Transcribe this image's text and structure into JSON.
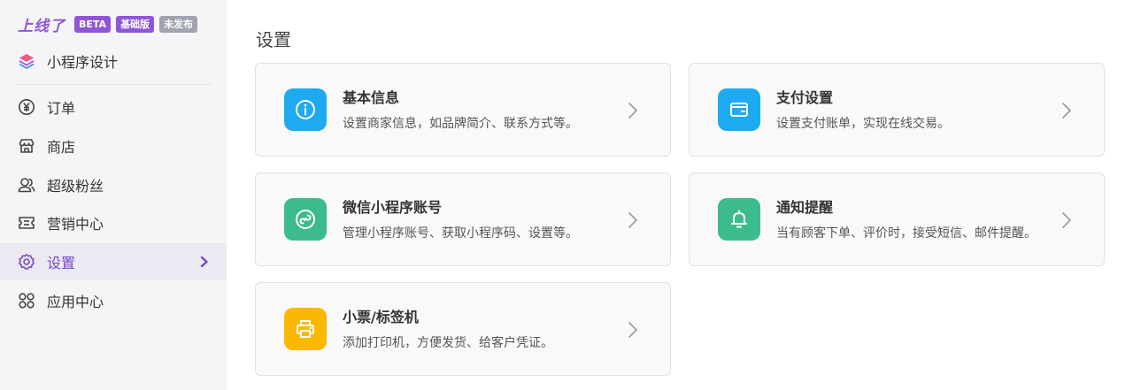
{
  "brand": {
    "logo": "上线了",
    "badges": [
      "BETA",
      "基础版",
      "未发布"
    ]
  },
  "sidebar": {
    "items": [
      {
        "label": "小程序设计",
        "icon": "layers-icon"
      },
      {
        "label": "订单",
        "icon": "yen-circle-icon"
      },
      {
        "label": "商店",
        "icon": "store-icon"
      },
      {
        "label": "超级粉丝",
        "icon": "fans-icon"
      },
      {
        "label": "营销中心",
        "icon": "ticket-icon"
      },
      {
        "label": "设置",
        "icon": "gear-icon",
        "active": true
      },
      {
        "label": "应用中心",
        "icon": "apps-icon"
      }
    ]
  },
  "main": {
    "title": "设置",
    "cards": [
      {
        "title": "基本信息",
        "desc": "设置商家信息，如品牌简介、联系方式等。",
        "icon": "info-icon",
        "color": "#1eaaf1"
      },
      {
        "title": "支付设置",
        "desc": "设置支付账单，实现在线交易。",
        "icon": "wallet-icon",
        "color": "#1eaaf1"
      },
      {
        "title": "微信小程序账号",
        "desc": "管理小程序账号、获取小程序码、设置等。",
        "icon": "miniprogram-icon",
        "color": "#3cbb8c"
      },
      {
        "title": "通知提醒",
        "desc": "当有顾客下单、评价时，接受短信、邮件提醒。",
        "icon": "bell-icon",
        "color": "#3cbb8c"
      },
      {
        "title": "小票/标签机",
        "desc": "添加打印机，方便发货、给客户凭证。",
        "icon": "printer-icon",
        "color": "#fbb800"
      }
    ]
  },
  "colors": {
    "accent": "#8f55d6",
    "sidebar_bg": "#f5f5f7",
    "active_bg": "#ebe9f1"
  }
}
